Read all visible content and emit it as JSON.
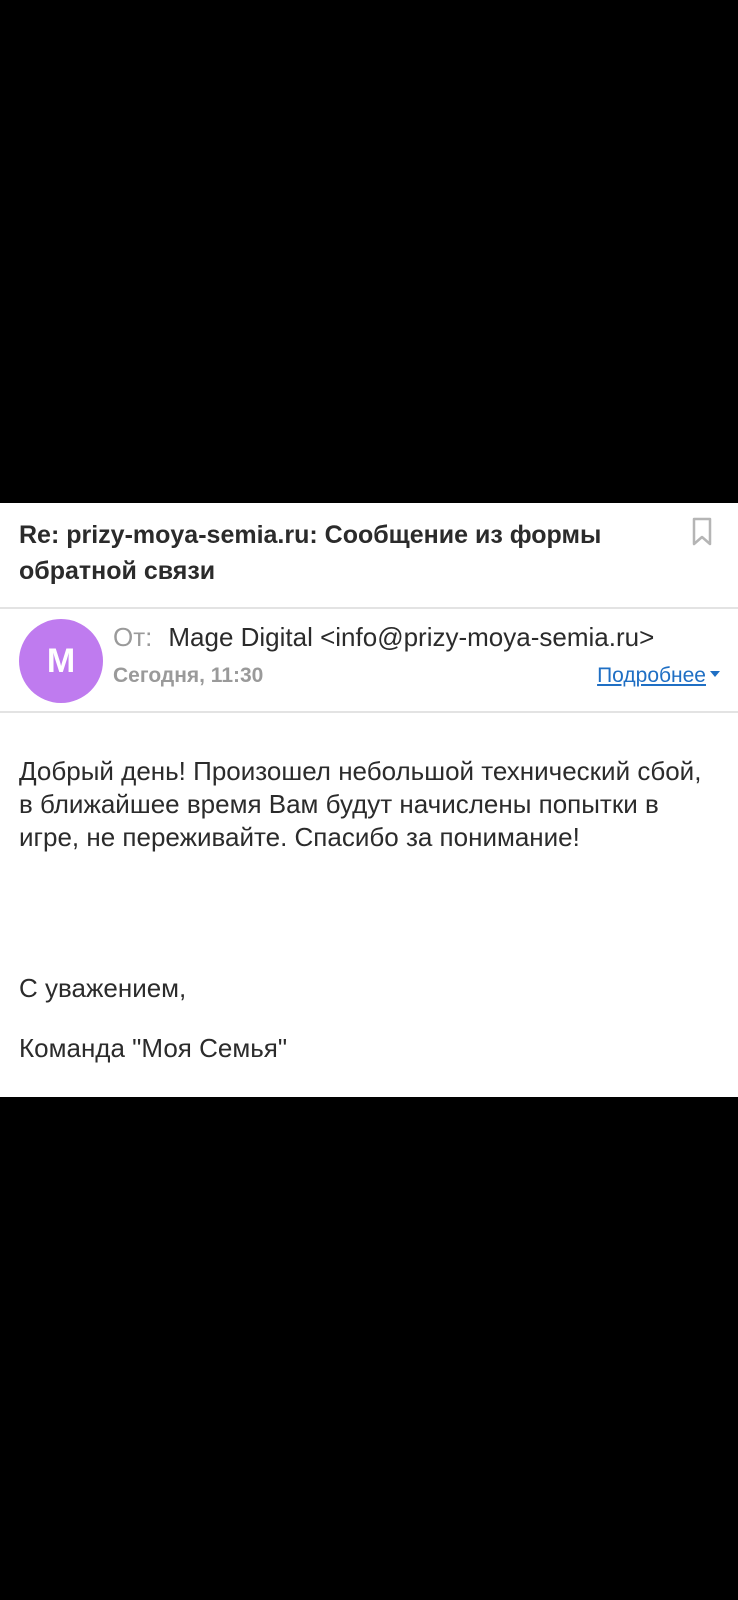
{
  "email": {
    "subject": "Re: prizy-moya-semia.ru: Сообщение из формы обратной связи",
    "from_label": "От:",
    "sender": "Mage Digital <info@prizy-moya-semia.ru>",
    "avatar_letter": "M",
    "date": "Сегодня, 11:30",
    "details_label": "Подробнее",
    "body_text": "Добрый день! Произошел небольшой технический сбой, в ближайшее время Вам будут начислены попытки в игре, не переживайте. Спасибо за понимание!",
    "regards": "С уважением,",
    "signature": "Команда \"Моя Семья\""
  },
  "colors": {
    "avatar_bg": "#bf7bef",
    "link": "#1f6fc4",
    "muted_text": "#9a9a9a",
    "main_text": "#2b2b2b"
  },
  "icons": {
    "bookmark": "bookmark-icon",
    "details_caret": "chevron-down-icon"
  }
}
